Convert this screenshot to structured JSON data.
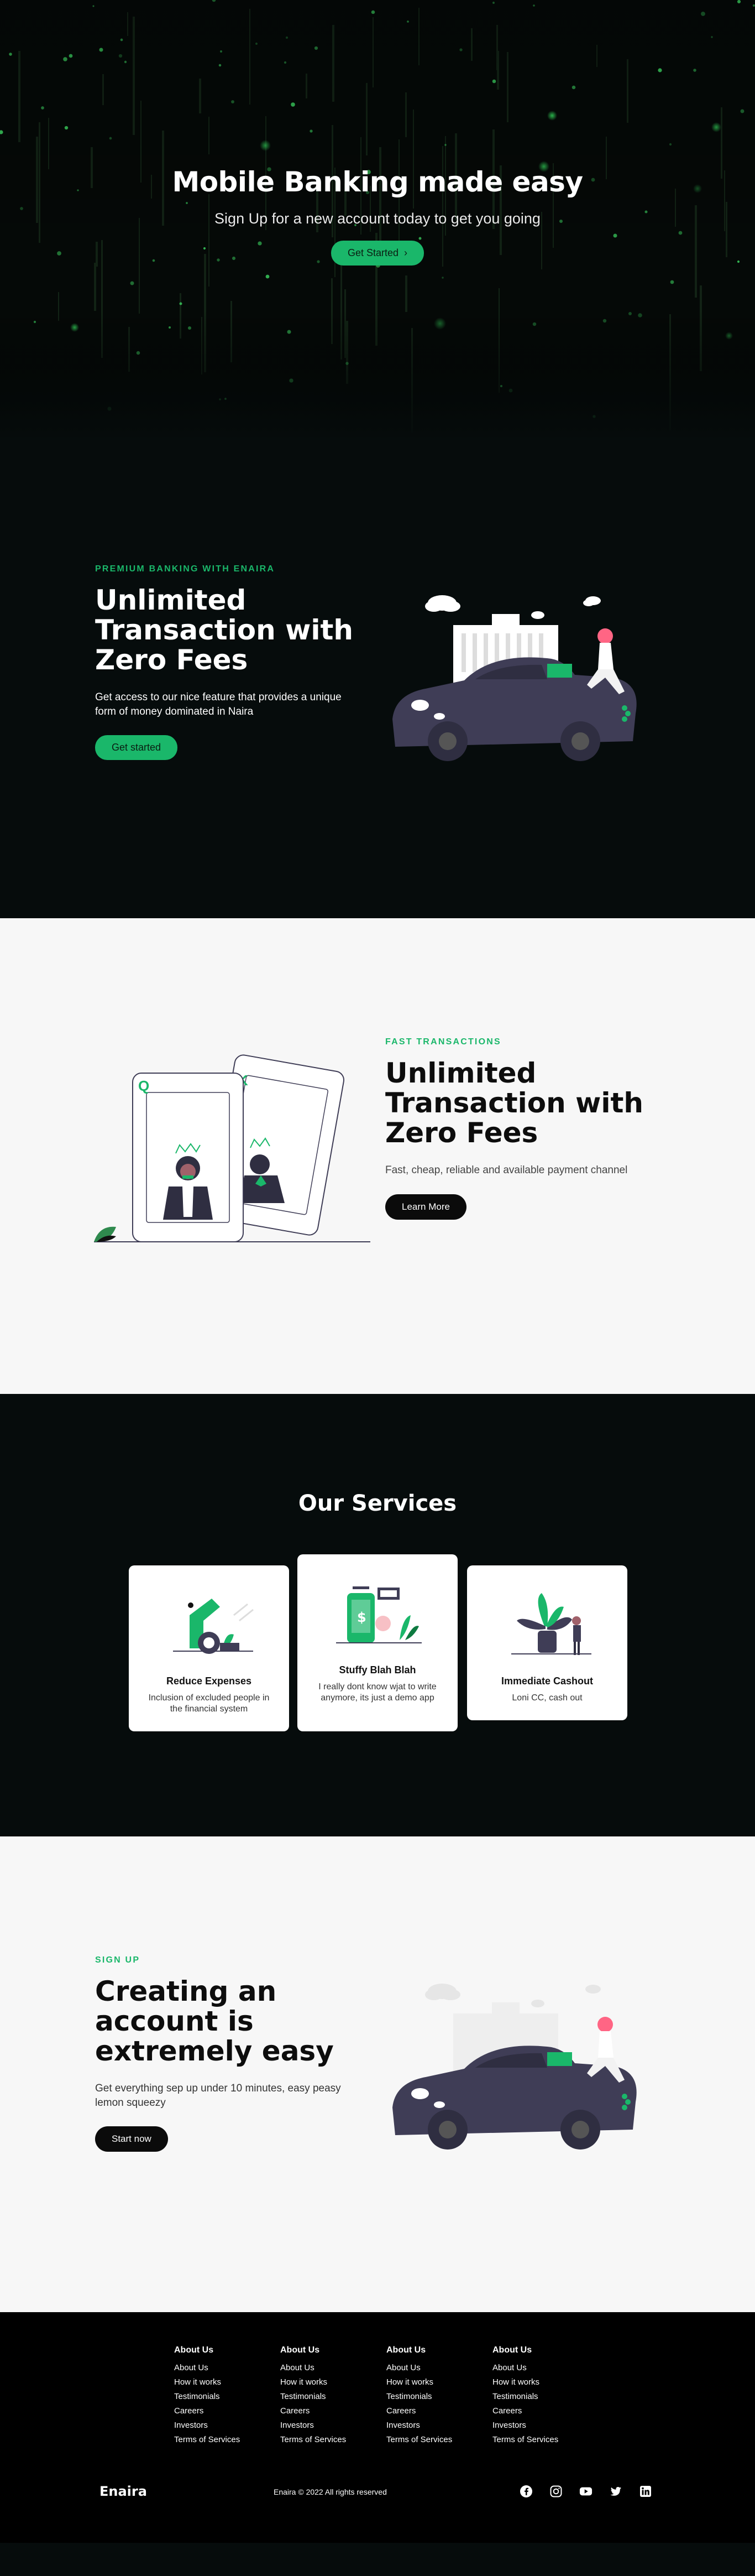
{
  "hero": {
    "title": "Mobile Banking made easy",
    "subtitle": "Sign Up for a new account today to get you going",
    "cta_label": "Get Started",
    "cta_arrow": "›"
  },
  "premium": {
    "eyebrow": "PREMIUM BANKING WITH ENAIRA",
    "title": "Unlimited Transaction with Zero Fees",
    "description": "Get access to our nice feature that provides a unique form of money dominated in Naira",
    "cta_label": "Get started"
  },
  "fast": {
    "eyebrow": "FAST TRANSACTIONS",
    "title": "Unlimited Transaction with Zero Fees",
    "description": "Fast, cheap, reliable and available payment channel",
    "cta_label": "Learn More",
    "card_letters": [
      "Q",
      "K"
    ]
  },
  "services": {
    "title": "Our Services",
    "cards": [
      {
        "title": "Reduce Expenses",
        "description": "Inclusion of excluded people in the financial system",
        "icon": "expenses-illustration"
      },
      {
        "title": "Stuffy Blah Blah",
        "description": "I really dont know wjat to write anymore, its just a demo app",
        "icon": "phone-illustration"
      },
      {
        "title": "Immediate Cashout",
        "description": "Loni CC, cash out",
        "icon": "plant-illustration"
      }
    ]
  },
  "signup": {
    "eyebrow": "SIGN UP",
    "title": "Creating an account is extremely easy",
    "description": "Get everything sep up under 10 minutes, easy peasy lemon squeezy",
    "cta_label": "Start now"
  },
  "footer": {
    "columns": [
      {
        "heading": "About Us",
        "links": [
          "About Us",
          "How it works",
          "Testimonials",
          "Careers",
          "Investors",
          "Terms of Services"
        ]
      },
      {
        "heading": "About Us",
        "links": [
          "About Us",
          "How it works",
          "Testimonials",
          "Careers",
          "Investors",
          "Terms of Services"
        ]
      },
      {
        "heading": "About Us",
        "links": [
          "About Us",
          "How it works",
          "Testimonials",
          "Careers",
          "Investors",
          "Terms of Services"
        ]
      },
      {
        "heading": "About Us",
        "links": [
          "About Us",
          "How it works",
          "Testimonials",
          "Careers",
          "Investors",
          "Terms of Services"
        ]
      }
    ],
    "brand": "Enaira",
    "copyright": "Enaira © 2022 All rights reserved",
    "socials": [
      "facebook-icon",
      "instagram-icon",
      "youtube-icon",
      "twitter-icon",
      "linkedin-icon"
    ]
  },
  "colors": {
    "accent": "#1ab76a",
    "dark_bg": "#060c0c",
    "light_bg": "#f7f7f7",
    "car": "#3f3d56"
  }
}
